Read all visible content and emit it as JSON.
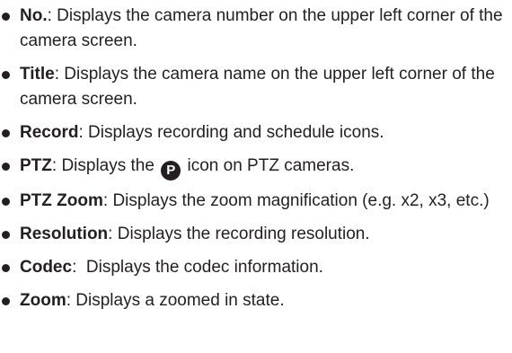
{
  "items": [
    {
      "term": "No.",
      "desc": ": Displays the camera number on the upper left corner of the camera screen."
    },
    {
      "term": "Title",
      "desc": ": Displays the camera name on the upper left corner of the camera screen."
    },
    {
      "term": "Record",
      "desc": ": Displays recording and schedule icons."
    },
    {
      "term": "PTZ",
      "desc_before": ": Displays the",
      "icon_letter": "P",
      "desc_after": "icon on PTZ cameras."
    },
    {
      "term": "PTZ Zoom",
      "desc": ": Displays the zoom magnification (e.g. x2, x3, etc.)"
    },
    {
      "term": "Resolution",
      "desc": ": Displays the recording resolution."
    },
    {
      "term": "Codec",
      "desc": ":  Displays the codec information."
    },
    {
      "term": "Zoom",
      "desc": ": Displays a zoomed in state."
    }
  ]
}
